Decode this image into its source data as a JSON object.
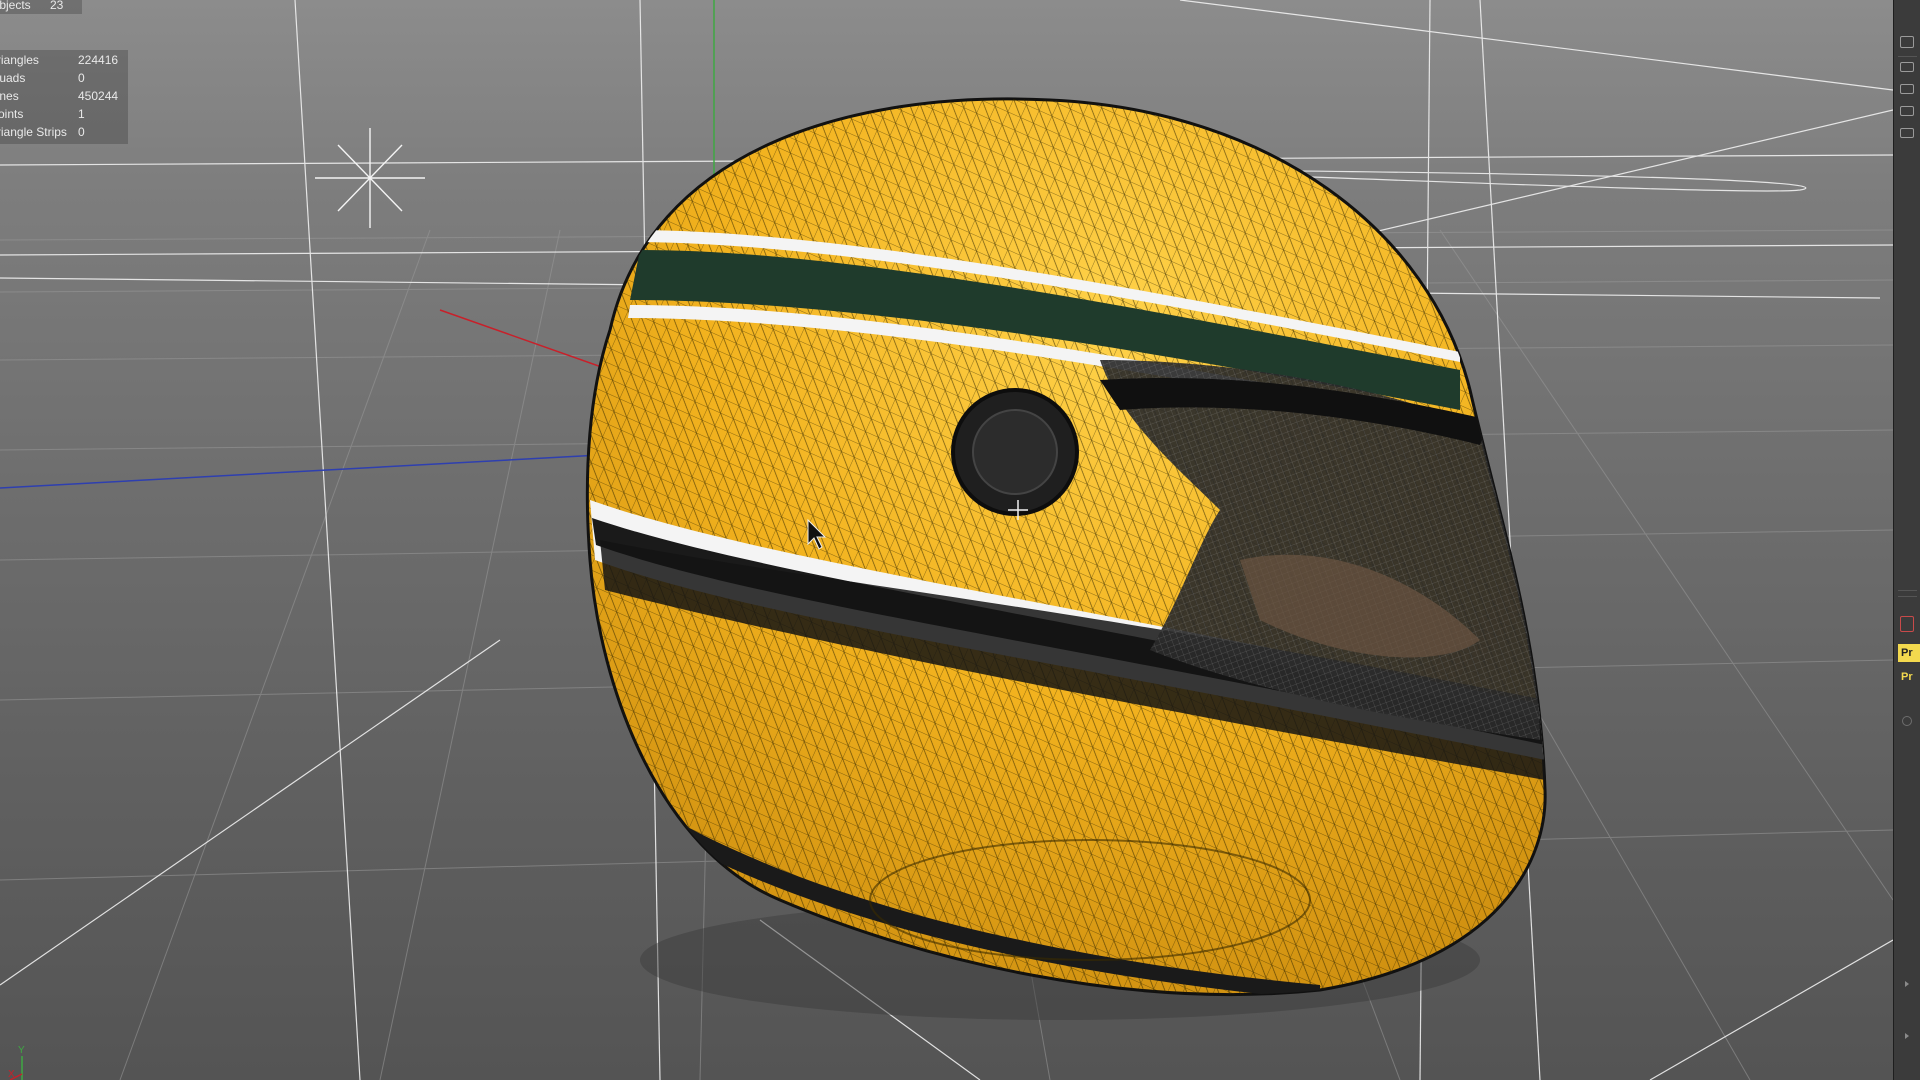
{
  "viewport": {
    "stats": [
      {
        "label": "Objects",
        "value": "23"
      },
      {
        "label": "Triangles",
        "value": "224416"
      },
      {
        "label": "Quads",
        "value": "0"
      },
      {
        "label": "Lines",
        "value": "450244"
      },
      {
        "label": "Points",
        "value": "1"
      },
      {
        "label": "Triangle Strips",
        "value": "0"
      }
    ],
    "axis_labels": {
      "y": "Y",
      "x": "X"
    },
    "colors": {
      "helmet_yellow": "#f2b21e",
      "stripe_green": "#1f3b2c",
      "stripe_white": "#f4f4f4",
      "axis_x": "#c8202a",
      "axis_y": "#3fa843",
      "axis_z": "#2e3fb0"
    }
  },
  "right_panel": {
    "tags": [
      "Pr",
      "Pr"
    ]
  }
}
